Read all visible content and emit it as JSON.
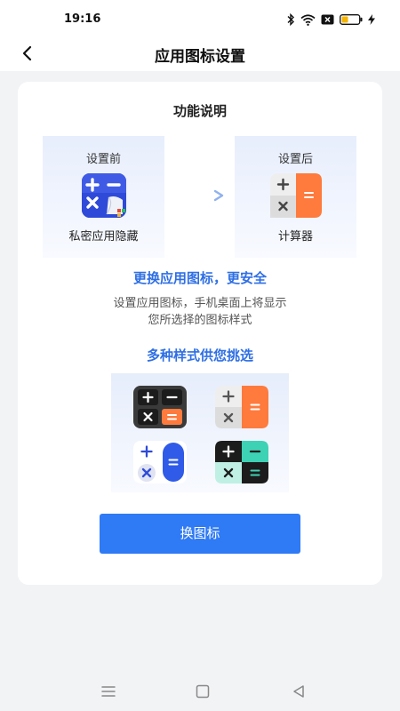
{
  "status_bar": {
    "time": "19:16",
    "icons": [
      "bluetooth-icon",
      "wifi-icon",
      "sim-off-icon",
      "battery-icon",
      "charging-icon"
    ],
    "battery_color": "#f5b400"
  },
  "nav": {
    "title": "应用图标设置",
    "back_icon": "chevron-left-icon"
  },
  "card": {
    "title": "功能说明",
    "before": {
      "top_label": "设置前",
      "bottom_label": "私密应用隐藏"
    },
    "after": {
      "top_label": "设置后",
      "bottom_label": "计算器"
    },
    "headline": "更换应用图标，更安全",
    "description_line1": "设置应用图标，手机桌面上将显示",
    "description_line2": "您所选择的图标样式",
    "styles_title": "多种样式供您挑选",
    "icon_symbols": {
      "plus": "+",
      "minus": "−",
      "times": "×",
      "equals": "="
    },
    "button_label": "换图标"
  },
  "colors": {
    "accent_blue": "#2f6fe4",
    "button_blue": "#2f7af5",
    "orange": "#ff7a3d",
    "teal": "#3dd2b4"
  },
  "bottom_nav": [
    "menu-icon",
    "home-icon",
    "back-triangle-icon"
  ]
}
